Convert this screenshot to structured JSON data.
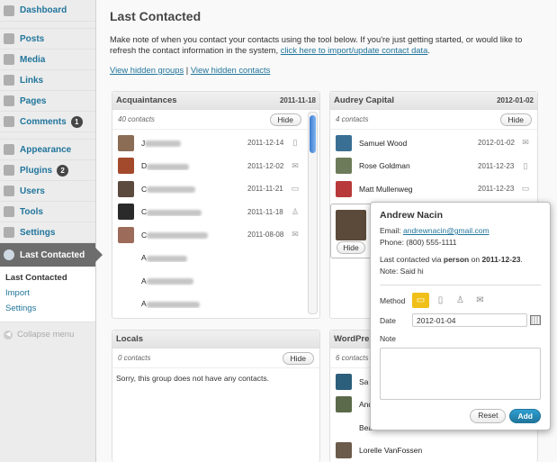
{
  "sidebar": {
    "items": [
      {
        "label": "Dashboard",
        "icon": "dashboard-icon"
      },
      {
        "label": "Posts",
        "icon": "posts-icon"
      },
      {
        "label": "Media",
        "icon": "media-icon"
      },
      {
        "label": "Links",
        "icon": "links-icon"
      },
      {
        "label": "Pages",
        "icon": "pages-icon"
      },
      {
        "label": "Comments",
        "icon": "comments-icon",
        "badge": "1"
      },
      {
        "label": "Appearance",
        "icon": "appearance-icon"
      },
      {
        "label": "Plugins",
        "icon": "plugins-icon",
        "badge": "2"
      },
      {
        "label": "Users",
        "icon": "users-icon"
      },
      {
        "label": "Tools",
        "icon": "tools-icon"
      },
      {
        "label": "Settings",
        "icon": "settings-icon"
      },
      {
        "label": "Last Contacted",
        "icon": "last-contacted-icon"
      }
    ],
    "submenu": [
      "Last Contacted",
      "Import",
      "Settings"
    ],
    "collapse": "Collapse menu"
  },
  "page": {
    "title": "Last Contacted",
    "intro": "Make note of when you contact your contacts using the tool below. If you're just getting started, or would like to refresh the contact information in the system,",
    "intro_link": "click here to import/update contact data",
    "view_hidden_groups": "View hidden groups",
    "separator": "|",
    "view_hidden_contacts": "View hidden contacts"
  },
  "groups": {
    "acquaintances": {
      "title": "Acquaintances",
      "date": "2011-11-18",
      "count": "40 contacts",
      "hide": "Hide",
      "contacts": [
        {
          "name": "J",
          "date": "2011-12-14",
          "method": "phone",
          "avatar": "#8b6c55"
        },
        {
          "name": "D",
          "date": "2011-12-02",
          "method": "email",
          "avatar": "#a34a2c"
        },
        {
          "name": "C",
          "date": "2011-11-21",
          "method": "chat",
          "avatar": "#5c4a3f"
        },
        {
          "name": "C",
          "date": "2011-11-18",
          "method": "person",
          "avatar": "#2a2a2a"
        },
        {
          "name": "C",
          "date": "2011-08-08",
          "method": "email",
          "avatar": "#9c6b5a"
        },
        {
          "name": "A",
          "date": "",
          "method": "",
          "avatar": ""
        },
        {
          "name": "A",
          "date": "",
          "method": "",
          "avatar": ""
        },
        {
          "name": "A",
          "date": "",
          "method": "",
          "avatar": ""
        }
      ]
    },
    "audrey": {
      "title": "Audrey Capital",
      "date": "2012-01-02",
      "count": "4 contacts",
      "hide": "Hide",
      "contacts": [
        {
          "name": "Samuel Wood",
          "date": "2012-01-02",
          "method": "email",
          "avatar": "#3a6f94"
        },
        {
          "name": "Rose Goldman",
          "date": "2011-12-23",
          "method": "phone",
          "avatar": "#6d7b5a"
        },
        {
          "name": "Matt Mullenweg",
          "date": "2011-12-23",
          "method": "chat",
          "avatar": "#b83a3a"
        }
      ],
      "selected_hide": "Hide"
    },
    "locals": {
      "title": "Locals",
      "count": "0 contacts",
      "hide": "Hide",
      "empty": "Sorry, this group does not have any contacts."
    },
    "wordpress": {
      "title": "WordPres",
      "count": "6 contacts",
      "contacts": [
        {
          "name": "Sa",
          "avatar": "#2c5f7c"
        },
        {
          "name": "And",
          "avatar": "#5a6a4a"
        },
        {
          "name": "Bea",
          "avatar": ""
        },
        {
          "name": "Lorelle VanFossen",
          "avatar": "#6b5b4b"
        }
      ]
    }
  },
  "popup": {
    "name": "Andrew Nacin",
    "email_label": "Email:",
    "email": "andrewnacin@gmail.com",
    "phone": "Phone: (800) 555-1111",
    "last_contacted_prefix": "Last contacted via",
    "last_contacted_method": "person",
    "last_contacted_on": "on",
    "last_contacted_date": "2011-12-23",
    "last_contacted_suffix": ".",
    "note_line": "Note: Said hi",
    "method_label": "Method",
    "date_label": "Date",
    "date_value": "2012-01-04",
    "note_label": "Note",
    "reset": "Reset",
    "add": "Add"
  }
}
